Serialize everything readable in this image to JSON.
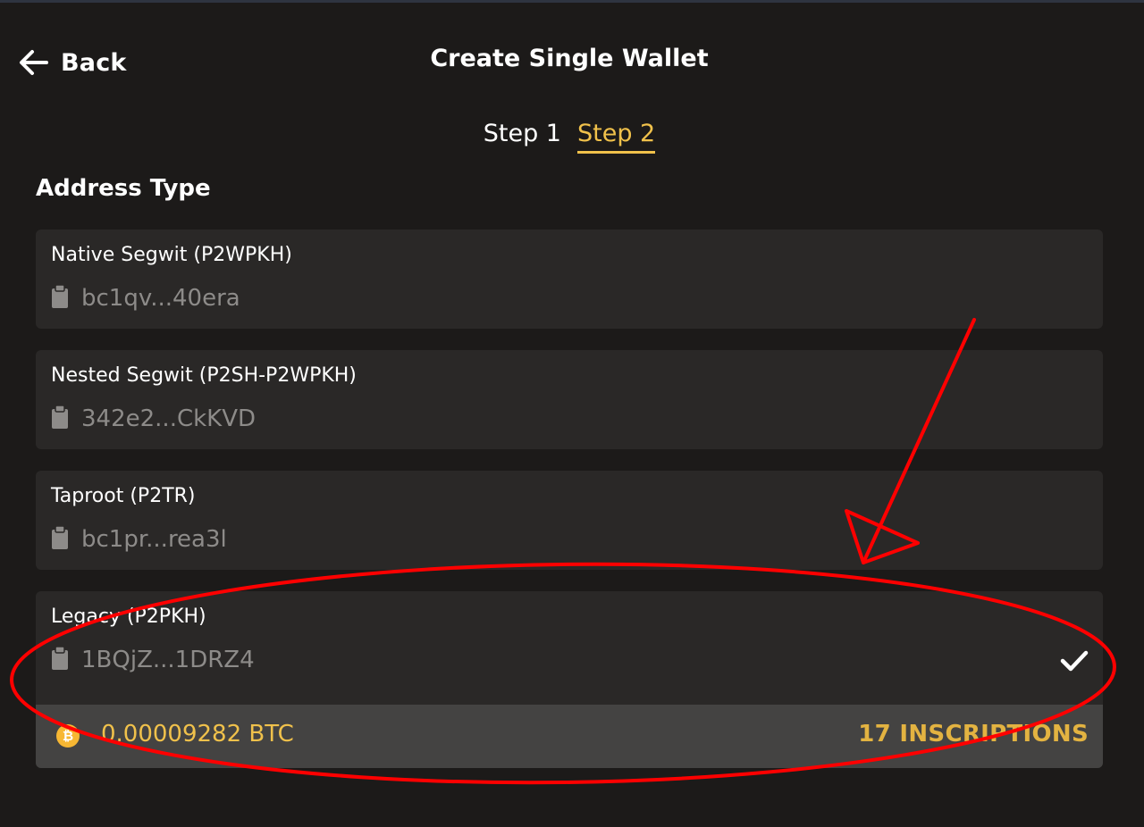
{
  "header": {
    "back_label": "Back",
    "title": "Create Single Wallet"
  },
  "steps": [
    {
      "label": "Step 1",
      "active": false
    },
    {
      "label": "Step 2",
      "active": true
    }
  ],
  "section_title": "Address Type",
  "address_types": [
    {
      "name": "Native Segwit (P2WPKH)",
      "address": "bc1qv...40era",
      "selected": false
    },
    {
      "name": "Nested Segwit (P2SH-P2WPKH)",
      "address": "342e2...CkKVD",
      "selected": false
    },
    {
      "name": "Taproot (P2TR)",
      "address": "bc1pr...rea3l",
      "selected": false
    },
    {
      "name": "Legacy (P2PKH)",
      "address": "1BQjZ...1DRZ4",
      "selected": true
    }
  ],
  "selected_balance": {
    "coin_symbol": "₿",
    "amount": "0.00009282 BTC",
    "inscriptions": "17 INSCRIPTIONS"
  },
  "icons": {
    "back": "arrow-left-icon",
    "copy": "clipboard-icon",
    "selected": "checkmark-icon",
    "coin": "bitcoin-icon"
  },
  "colors": {
    "background": "#1c1a19",
    "card": "#2a2827",
    "accent": "#f0c14b",
    "annotation": "#ff0000"
  }
}
